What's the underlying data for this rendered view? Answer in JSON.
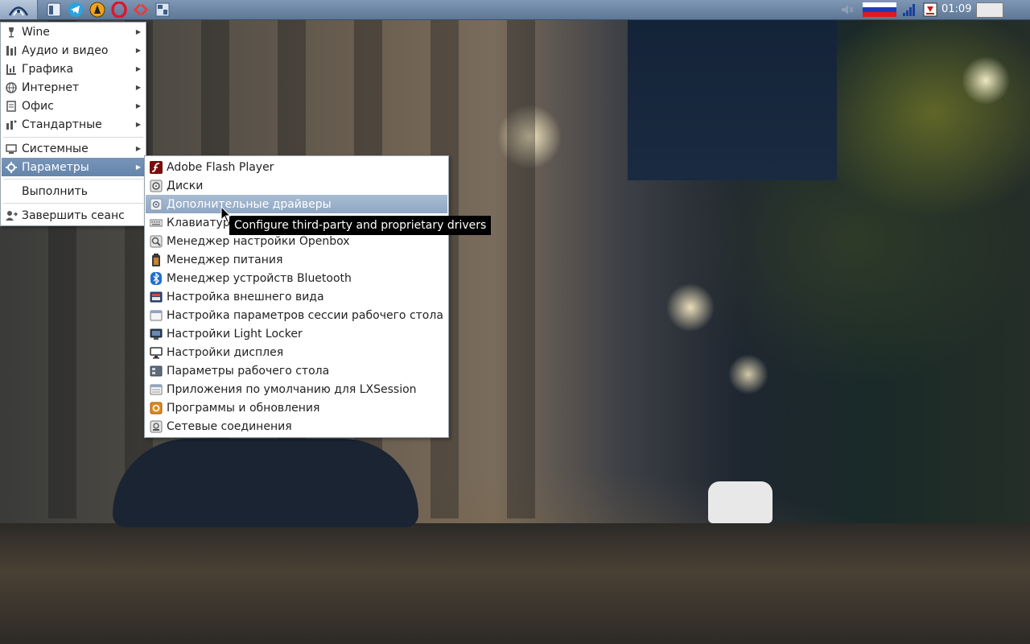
{
  "taskbar": {
    "clock": "01:09",
    "launchers": [
      {
        "icon": "start-menu-icon"
      },
      {
        "icon": "file-manager-icon"
      },
      {
        "icon": "telegram-icon"
      },
      {
        "icon": "vlc-icon"
      },
      {
        "icon": "opera-icon"
      },
      {
        "icon": "double-commander-icon"
      },
      {
        "icon": "window-switcher-icon"
      }
    ],
    "tray": [
      {
        "icon": "volume-muted-icon"
      },
      {
        "icon": "keyboard-layout-ru-flag-icon"
      },
      {
        "icon": "network-signal-icon"
      },
      {
        "icon": "update-notifier-icon"
      }
    ]
  },
  "main_menu": {
    "items": [
      {
        "label": "Wine",
        "icon": "wine-icon",
        "submenu": true
      },
      {
        "label": "Аудио и видео",
        "icon": "audio-video-icon",
        "submenu": true
      },
      {
        "label": "Графика",
        "icon": "graphics-icon",
        "submenu": true
      },
      {
        "label": "Интернет",
        "icon": "internet-icon",
        "submenu": true
      },
      {
        "label": "Офис",
        "icon": "office-icon",
        "submenu": true
      },
      {
        "label": "Стандартные",
        "icon": "accessories-icon",
        "submenu": true
      },
      {
        "label": "Системные",
        "icon": "system-icon",
        "submenu": true
      },
      {
        "label": "Параметры",
        "icon": "preferences-icon",
        "submenu": true,
        "selected": true
      },
      {
        "label": "Выполнить",
        "icon": "",
        "submenu": false
      },
      {
        "label": "Завершить сеанс",
        "icon": "logout-icon",
        "submenu": false
      }
    ]
  },
  "sub_menu": {
    "items": [
      {
        "label": "Adobe Flash Player",
        "icon": "flash-icon"
      },
      {
        "label": "Диски",
        "icon": "disks-icon"
      },
      {
        "label": "Дополнительные драйверы",
        "icon": "drivers-icon",
        "hover": true
      },
      {
        "label": "Клавиатура",
        "icon": "keyboard-icon"
      },
      {
        "label": "Менеджер настройки Openbox",
        "icon": "openbox-icon"
      },
      {
        "label": "Менеджер питания",
        "icon": "power-icon"
      },
      {
        "label": "Менеджер устройств Bluetooth",
        "icon": "bluetooth-icon"
      },
      {
        "label": "Настройка внешнего вида",
        "icon": "appearance-icon"
      },
      {
        "label": "Настройка параметров сессии рабочего стола",
        "icon": "session-icon"
      },
      {
        "label": "Настройки Light Locker",
        "icon": "light-locker-icon"
      },
      {
        "label": "Настройки дисплея",
        "icon": "display-icon"
      },
      {
        "label": "Параметры рабочего стола",
        "icon": "desktop-settings-icon"
      },
      {
        "label": "Приложения по умолчанию для LXSession",
        "icon": "default-apps-icon"
      },
      {
        "label": "Программы и обновления",
        "icon": "software-updates-icon"
      },
      {
        "label": "Сетевые соединения",
        "icon": "network-connections-icon"
      }
    ]
  },
  "tooltip": {
    "text": "Configure third-party and proprietary drivers"
  },
  "colors": {
    "menu_highlight": "#6a88ae",
    "taskbar": "#6c86a5"
  }
}
